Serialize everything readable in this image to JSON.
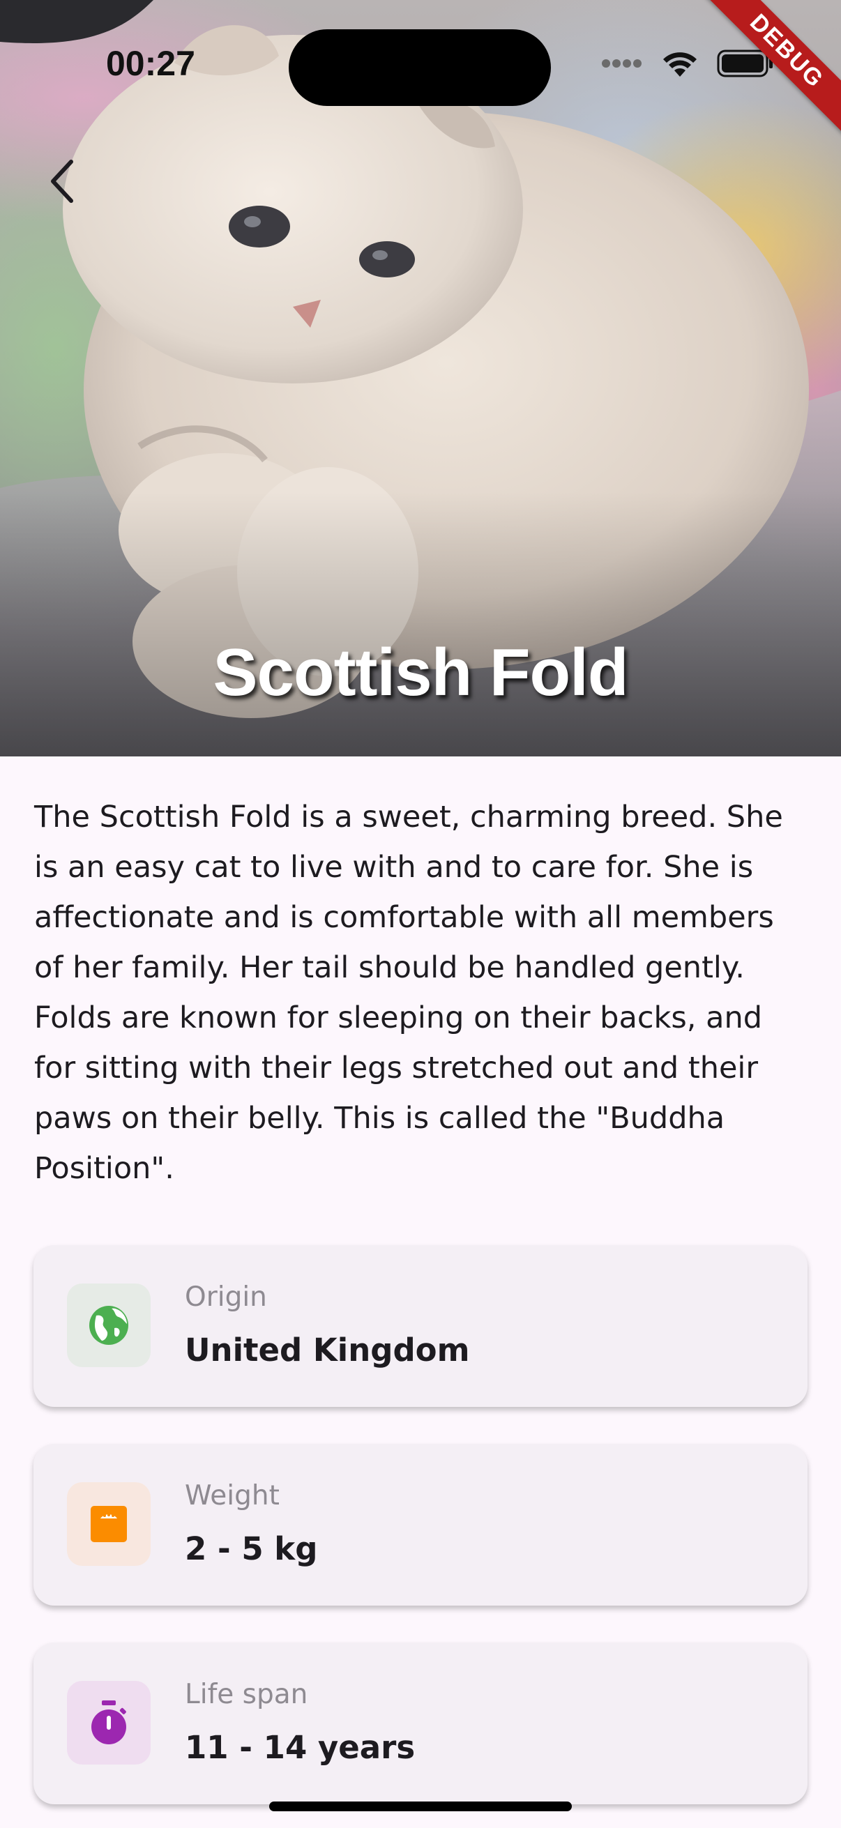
{
  "status_bar": {
    "time": "00:27",
    "debug_banner": "DEBUG"
  },
  "hero": {
    "title": "Scottish Fold"
  },
  "description": "The Scottish Fold is a sweet, charming breed. She is an easy cat to live with and to care for. She is affectionate and is comfortable with all members of her family. Her tail should be handled gently. Folds are known for sleeping on their backs, and for sitting with their legs stretched out and their paws on their belly. This is called the \"Buddha Position\".",
  "info_cards": [
    {
      "label": "Origin",
      "value": "United Kingdom",
      "icon": "globe-icon",
      "color": "#4caf50",
      "bg": "#e6ebe6"
    },
    {
      "label": "Weight",
      "value": "2 - 5 kg",
      "icon": "scale-icon",
      "color": "#fb8c00",
      "bg": "#f8e7df"
    },
    {
      "label": "Life span",
      "value": "11 - 14 years",
      "icon": "timer-icon",
      "color": "#9c27b0",
      "bg": "#efddf0"
    }
  ]
}
